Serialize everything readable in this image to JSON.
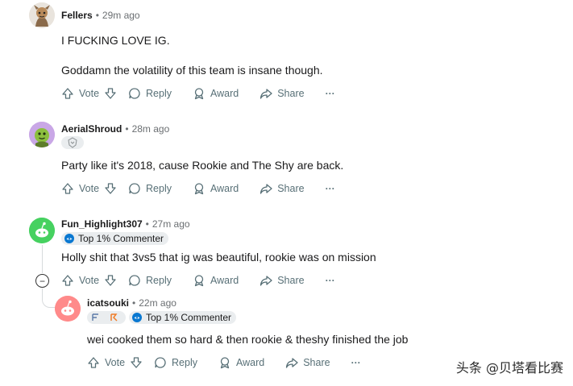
{
  "comments": [
    {
      "username": "Fellers",
      "time": "29m ago",
      "body_lines": [
        "I FUCKING LOVE IG.",
        "Goddamn the volatility of this team is insane though."
      ],
      "vote_label": "Vote",
      "reply_label": "Reply",
      "award_label": "Award",
      "share_label": "Share",
      "more_label": "···"
    },
    {
      "username": "AerialShroud",
      "time": "28m ago",
      "body_lines": [
        "Party like it's 2018, cause Rookie and The Shy are back."
      ],
      "vote_label": "Vote",
      "reply_label": "Reply",
      "award_label": "Award",
      "share_label": "Share",
      "more_label": "···"
    },
    {
      "username": "Fun_Highlight307",
      "time": "27m ago",
      "flair": "Top 1% Commenter",
      "body_lines": [
        "Holly shit that 3vs5 that ig was beautiful, rookie was on mission"
      ],
      "vote_label": "Vote",
      "reply_label": "Reply",
      "award_label": "Award",
      "share_label": "Share",
      "more_label": "···"
    },
    {
      "username": "icatsouki",
      "time": "22m ago",
      "flair": "Top 1% Commenter",
      "body_lines": [
        "wei cooked them so hard & then rookie & theshy finished the job"
      ],
      "vote_label": "Vote",
      "reply_label": "Reply",
      "award_label": "Award",
      "share_label": "Share",
      "more_label": "···"
    }
  ],
  "dot": "•",
  "collapse_symbol": "−",
  "watermark": "头条 @贝塔看比赛",
  "colors": {
    "meta": "#6b6f72",
    "action": "#576f76",
    "flair_bg": "#eaedef",
    "thread_line": "#d7dadc"
  }
}
